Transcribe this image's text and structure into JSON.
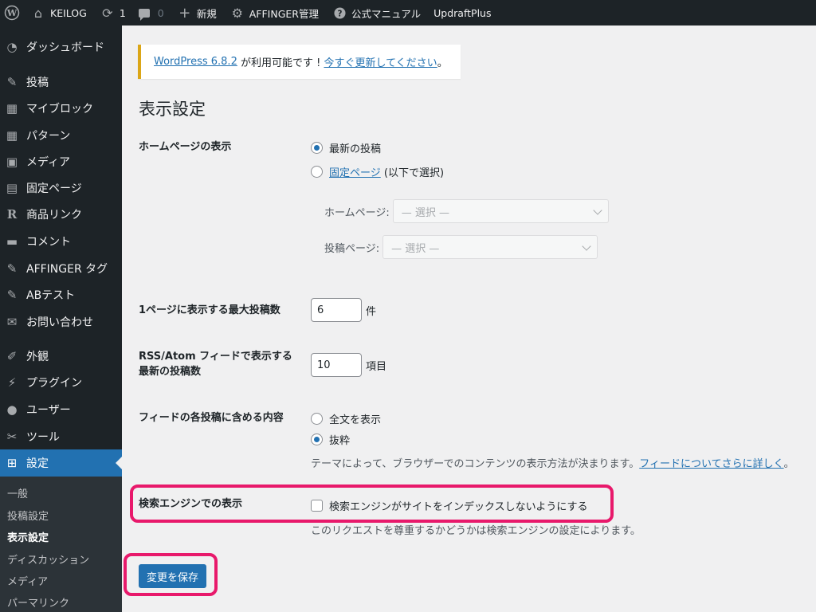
{
  "adminbar": {
    "site_name": "KEILOG",
    "updates_count": "1",
    "comments_count": "0",
    "new_label": "新規",
    "affinger_label": "AFFINGER管理",
    "manual_label": "公式マニュアル",
    "updraft_label": "UpdraftPlus"
  },
  "sidebar": {
    "items": [
      {
        "label": "ダッシュボード",
        "icon": "dashboard-icon"
      },
      {
        "label": "投稿",
        "icon": "pin-icon"
      },
      {
        "label": "マイブロック",
        "icon": "grid-icon"
      },
      {
        "label": "パターン",
        "icon": "grid-icon"
      },
      {
        "label": "メディア",
        "icon": "media-icon"
      },
      {
        "label": "固定ページ",
        "icon": "page-icon"
      },
      {
        "label": "商品リンク",
        "icon": "r-icon"
      },
      {
        "label": "コメント",
        "icon": "comment-icon"
      },
      {
        "label": "AFFINGER タグ",
        "icon": "pin-icon"
      },
      {
        "label": "ABテスト",
        "icon": "pin-icon"
      },
      {
        "label": "お問い合わせ",
        "icon": "mail-icon"
      },
      {
        "label": "外観",
        "icon": "brush-icon"
      },
      {
        "label": "プラグイン",
        "icon": "plugin-icon"
      },
      {
        "label": "ユーザー",
        "icon": "user-icon"
      },
      {
        "label": "ツール",
        "icon": "wrench-icon"
      },
      {
        "label": "設定",
        "icon": "settings-icon"
      }
    ],
    "submenu": [
      "一般",
      "投稿設定",
      "表示設定",
      "ディスカッション",
      "メディア",
      "パーマリンク"
    ]
  },
  "notice": {
    "version_link": "WordPress 6.8.2",
    "text": " が利用可能です ! ",
    "update_link": "今すぐ更新してください",
    "end": "。"
  },
  "page_title": "表示設定",
  "homepage": {
    "label": "ホームページの表示",
    "option_latest": "最新の投稿",
    "option_static_link": "固定ページ",
    "option_static_rest": " (以下で選択)",
    "front_label": "ホームページ:",
    "front_value": "— 選択 —",
    "posts_label": "投稿ページ:",
    "posts_value": "— 選択 —"
  },
  "posts_per_page": {
    "label": "1ページに表示する最大投稿数",
    "value": "6",
    "unit": "件"
  },
  "rss": {
    "label_line1": "RSS/Atom フィードで表示する",
    "label_line2": "最新の投稿数",
    "value": "10",
    "unit": "項目"
  },
  "feed_content": {
    "label": "フィードの各投稿に含める内容",
    "option_full": "全文を表示",
    "option_excerpt": "抜粋",
    "desc": "テーマによって、ブラウザーでのコンテンツの表示方法が決まります。",
    "desc_link": "フィードについてさらに詳しく",
    "desc_end": "。"
  },
  "search_engine": {
    "label": "検索エンジンでの表示",
    "checkbox_label": "検索エンジンがサイトをインデックスしないようにする",
    "desc": "このリクエストを尊重するかどうかは検索エンジンの設定によります。"
  },
  "save_label": "変更を保存",
  "colors": {
    "accent": "#2271b1",
    "highlight": "#e8196b",
    "sidebar_bg": "#1d2327"
  }
}
